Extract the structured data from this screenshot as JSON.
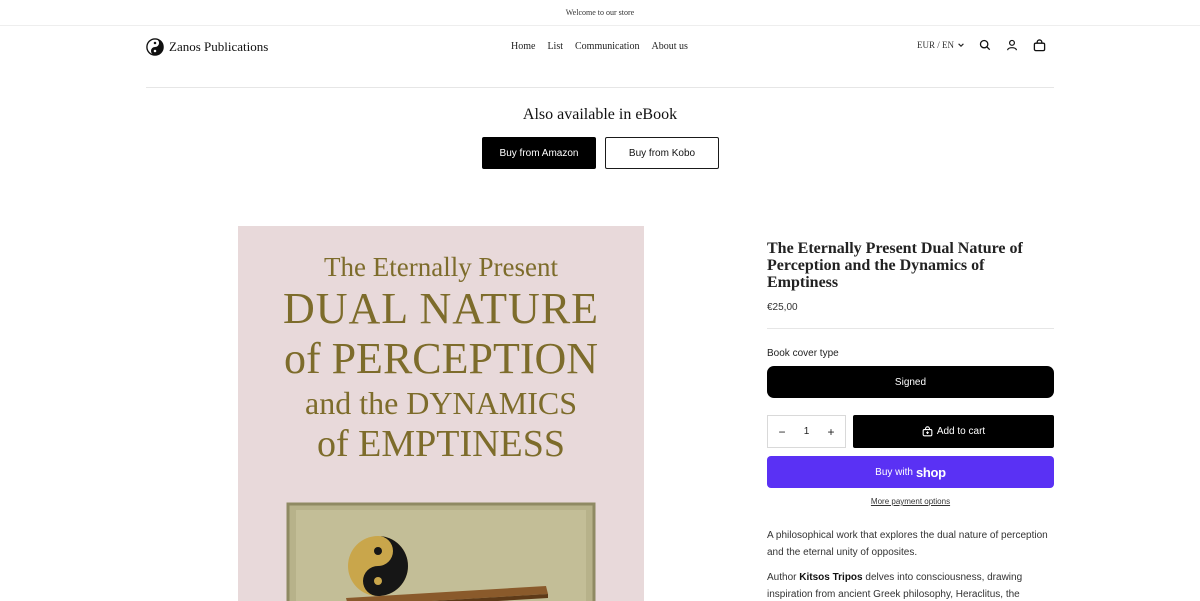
{
  "announcement": "Welcome to our store",
  "header": {
    "brand": "Zanos Publications",
    "nav": [
      "Home",
      "List",
      "Communication",
      "About us"
    ],
    "locale": "EUR / EN",
    "icons": [
      "search-icon",
      "account-icon",
      "cart-icon"
    ]
  },
  "ebook": {
    "title": "Also available in eBook",
    "amazon_label": "Buy from Amazon",
    "kobo_label": "Buy from Kobo"
  },
  "cover": {
    "lines": [
      "The Eternally Present",
      "DUAL  NATURE",
      "of PERCEPTION",
      "and the DYNAMICS",
      "of EMPTINESS"
    ]
  },
  "product": {
    "title": "The Eternally Present Dual Nature of Perception and the Dynamics of Emptiness",
    "price": "€25,00",
    "variant_label": "Book cover type",
    "variant_value": "Signed",
    "quantity": "1",
    "qty_minus": "−",
    "qty_plus": "+",
    "add_to_cart": "Add to cart",
    "buy_with": "Buy with",
    "shop_word": "shop",
    "more_payment": "More payment options",
    "description": "A philosophical work that explores the dual nature of perception and the eternal unity of opposites.",
    "author_prefix": "Author ",
    "author_name": "Kitsos Tripos",
    "author_rest": " delves into consciousness, drawing inspiration from ancient Greek philosophy, Heraclitus, the thought of Carl Jung, and quantum physics."
  },
  "colors": {
    "cover_bg": "#e8d9da",
    "cover_text": "#7d6c2b",
    "shop_pay": "#5a31f4"
  }
}
